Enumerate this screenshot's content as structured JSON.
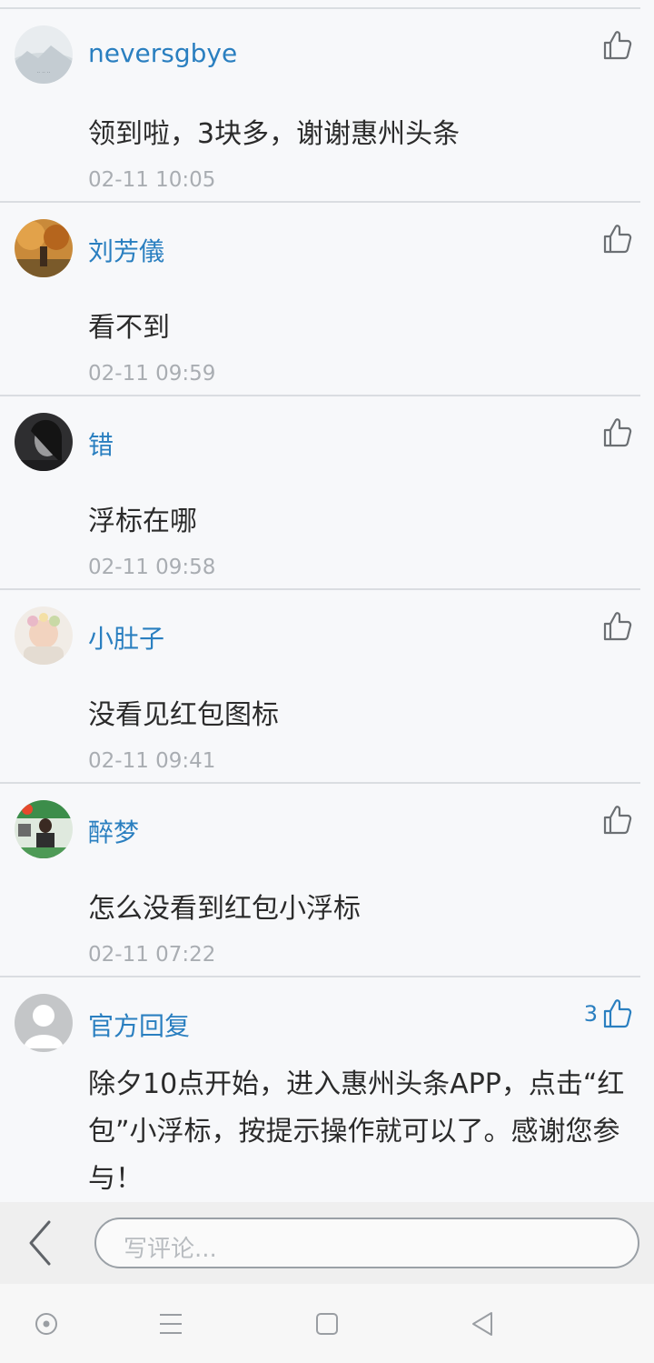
{
  "comments": [
    {
      "username": "neversgbye",
      "text": "领到啦，3块多，谢谢惠州头条",
      "time": "02-11 10:05",
      "likes": "",
      "avatar": "landscape-avatar"
    },
    {
      "username": "刘芳儀",
      "text": "看不到",
      "time": "02-11 09:59",
      "likes": "",
      "avatar": "autumn-photo-avatar"
    },
    {
      "username": "错",
      "text": "浮标在哪",
      "time": "02-11 09:58",
      "likes": "",
      "avatar": "portrait-avatar"
    },
    {
      "username": "小肚子",
      "text": "没看见红包图标",
      "time": "02-11 09:41",
      "likes": "",
      "avatar": "baby-photo-avatar"
    },
    {
      "username": "醉梦",
      "text": "怎么没看到红包小浮标",
      "time": "02-11 07:22",
      "likes": "",
      "avatar": "person-photo-avatar"
    },
    {
      "username": "官方回复",
      "text": "除夕10点开始，进入惠州头条APP，点击“红包”小浮标，按提示操作就可以了。感谢您参与！",
      "time": "",
      "likes": "3",
      "avatar": "default-user-avatar"
    }
  ],
  "composer": {
    "placeholder": "写评论..."
  },
  "colors": {
    "accent": "#2a7fc0",
    "separator": "#dadde1",
    "timestamp": "#a9adb2"
  },
  "icons": {
    "like": "thumbs-up-icon",
    "back": "chevron-left-icon",
    "nav": [
      "circle-home-icon",
      "menu-lines-icon",
      "square-recents-icon",
      "triangle-back-icon"
    ]
  }
}
